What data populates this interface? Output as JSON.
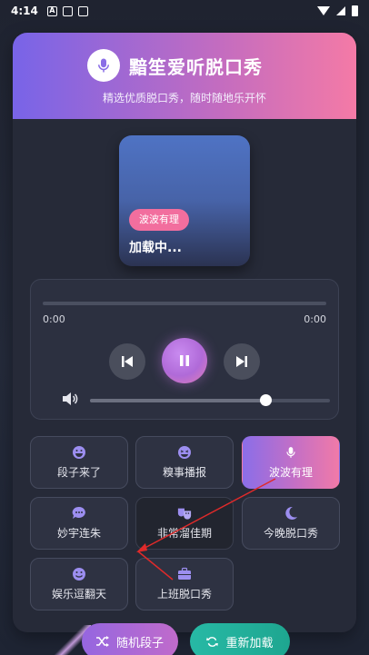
{
  "status_bar": {
    "time": "4:14",
    "notif_a": "A"
  },
  "header": {
    "title": "黯笙爱听脱口秀",
    "subtitle": "精选优质脱口秀，随时随地乐开怀"
  },
  "now_playing": {
    "tag": "波波有理",
    "status": "加载中..."
  },
  "player": {
    "current_time": "0:00",
    "total_time": "0:00",
    "progress": 0,
    "volume": 0.73
  },
  "categories": [
    {
      "label": "段子来了",
      "icon": "laugh-icon"
    },
    {
      "label": "糗事播报",
      "icon": "grin-squint-icon"
    },
    {
      "label": "波波有理",
      "icon": "microphone-icon",
      "active": true
    },
    {
      "label": "妙宇连朱",
      "icon": "comment-dots-icon"
    },
    {
      "label": "非常溜佳期",
      "icon": "theater-masks-icon"
    },
    {
      "label": "今晚脱口秀",
      "icon": "moon-icon"
    },
    {
      "label": "娱乐逗翻天",
      "icon": "smile-icon"
    },
    {
      "label": "上班脱口秀",
      "icon": "briefcase-icon"
    }
  ],
  "actions": {
    "random_label": "随机段子",
    "reload_label": "重新加载"
  },
  "colors": {
    "accent_purple": "#7864e8",
    "accent_pink": "#f47aa6",
    "teal": "#1ea690",
    "annotation_red": "#e02a2a"
  }
}
